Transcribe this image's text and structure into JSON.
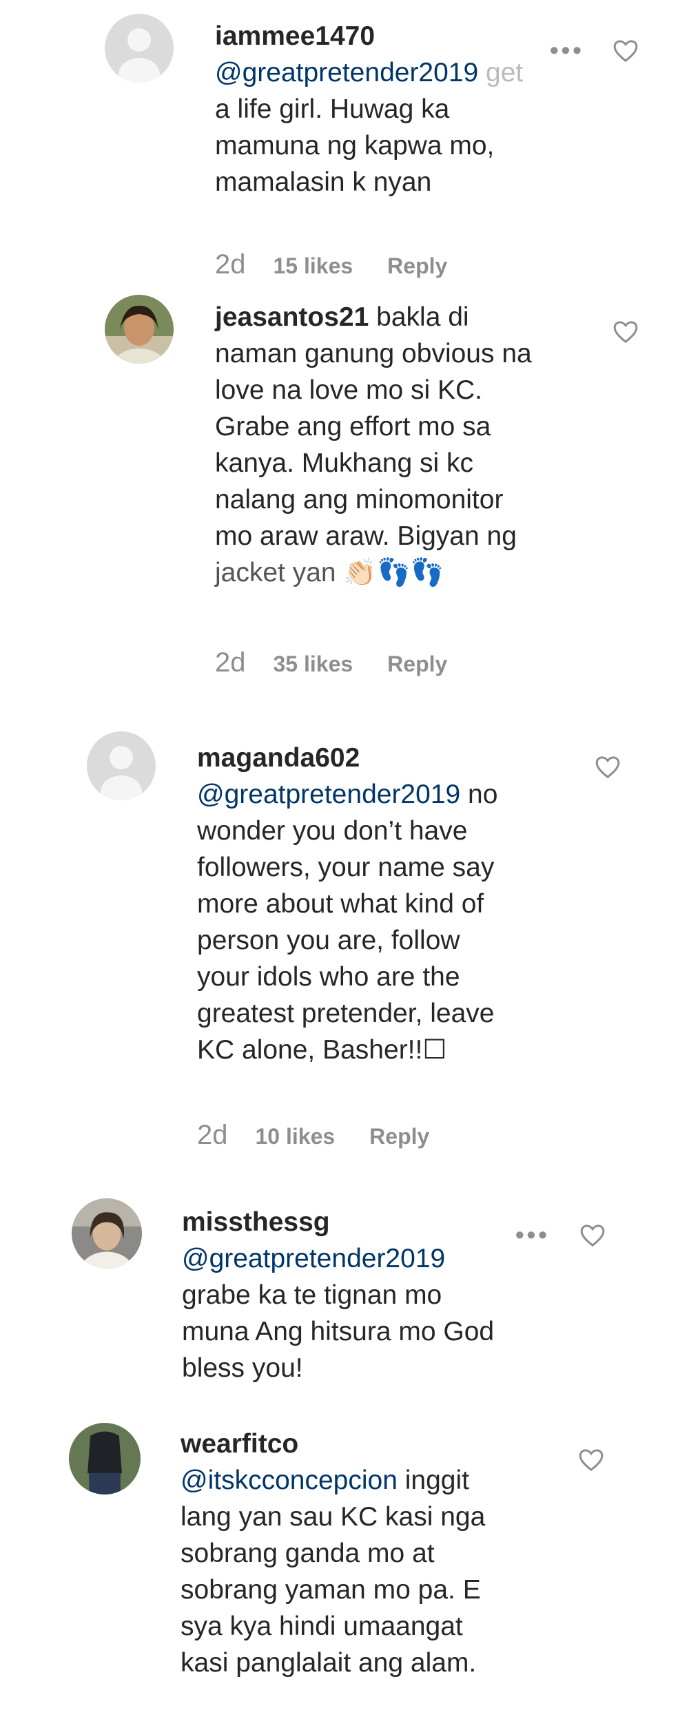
{
  "colors": {
    "text": "#262626",
    "muted": "#8e8e8e",
    "mention": "#003569",
    "heart": "#8e8e8e"
  },
  "comments": [
    {
      "username": "iammee1470",
      "mention": "@greatpretender2019",
      "text_after_mention_line1": " get",
      "lines": [
        "a life girl. Huwag ka",
        "mamuna ng kapwa mo,",
        "mamalasin k nyan"
      ],
      "time": "2d",
      "likes": "15 likes",
      "reply": "Reply",
      "more": "•••"
    },
    {
      "username": "jeasantos21",
      "first_line_rest": " bakla di",
      "lines": [
        "naman ganung obvious na",
        "love na love mo si KC.",
        "Grabe ang effort mo sa",
        "kanya. Mukhang si kc",
        "nalang ang minomonitor",
        "mo araw araw. Bigyan ng",
        "jacket yan 👏🏻👣👣"
      ],
      "time": "2d",
      "likes": "35 likes",
      "reply": "Reply"
    },
    {
      "username": "maganda602",
      "mention": "@greatpretender2019",
      "text_after_mention_line1": " no",
      "lines": [
        "wonder you don’t have",
        "followers, your name say",
        "more about what kind of",
        "person you are, follow",
        "your idols who are the",
        "greatest pretender, leave",
        "KC alone, Basher!!☐"
      ],
      "time": "2d",
      "likes": "10 likes",
      "reply": "Reply"
    },
    {
      "username": "missthessg",
      "mention": "@greatpretender2019",
      "lines": [
        "grabe ka te tignan mo",
        "muna Ang hitsura mo God",
        "bless you!"
      ],
      "more": "•••"
    },
    {
      "username": "wearfitco",
      "mention": "@itskcconcepcion",
      "text_after_mention_line1": " inggit",
      "lines": [
        "lang yan sau KC kasi nga",
        "sobrang ganda mo at",
        "sobrang yaman mo pa. E",
        "sya kya hindi umaangat",
        "kasi panglalait ang alam."
      ]
    }
  ]
}
